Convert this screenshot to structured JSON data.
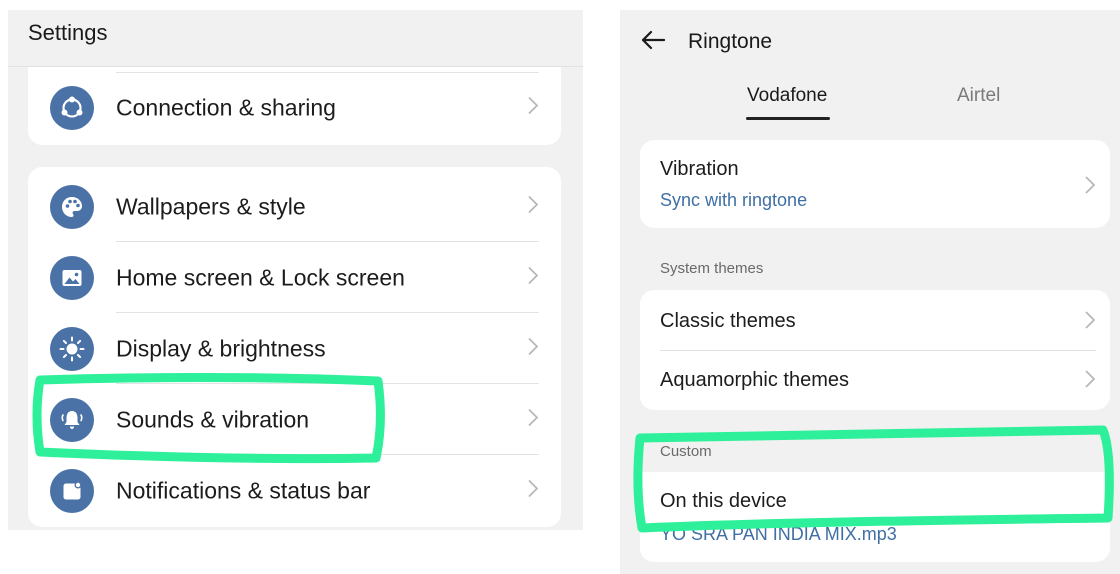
{
  "left": {
    "title": "Settings",
    "items": [
      {
        "label": "Connection & sharing",
        "icon": "share-icon"
      },
      {
        "label": "Wallpapers & style",
        "icon": "palette-icon"
      },
      {
        "label": "Home screen & Lock screen",
        "icon": "image-icon"
      },
      {
        "label": "Display & brightness",
        "icon": "sun-icon"
      },
      {
        "label": "Sounds & vibration",
        "icon": "bell-icon"
      },
      {
        "label": "Notifications & status bar",
        "icon": "notification-icon"
      }
    ]
  },
  "right": {
    "title": "Ringtone",
    "tabs": [
      {
        "label": "Vodafone",
        "active": true
      },
      {
        "label": "Airtel",
        "active": false
      }
    ],
    "vibration": {
      "label": "Vibration",
      "value": "Sync with ringtone"
    },
    "system_themes": {
      "section_label": "System themes",
      "items": [
        "Classic themes",
        "Aquamorphic themes"
      ]
    },
    "custom": {
      "section_label": "Custom",
      "label": "On this device",
      "value": "YO SRA PAN INDIA MIX.mp3"
    }
  },
  "colors": {
    "icon_bg": "#4a72a6",
    "link": "#3f6fa3",
    "highlight": "#2ff09a",
    "panel_bg": "#f1f1f2"
  }
}
